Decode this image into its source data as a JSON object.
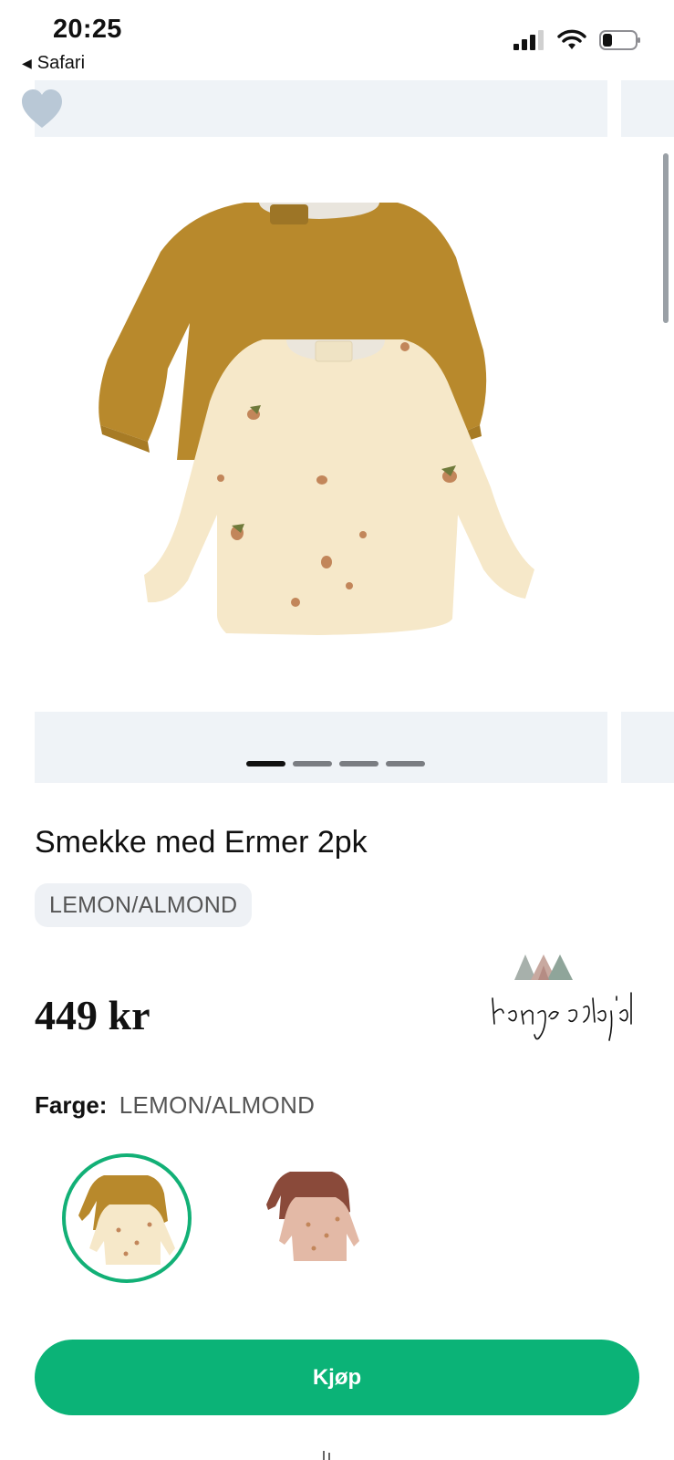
{
  "status_bar": {
    "time": "20:25",
    "back_label": "Safari",
    "icons": [
      "signal-icon",
      "wifi-icon",
      "battery-icon"
    ]
  },
  "gallery": {
    "favorite_icon": "heart-icon",
    "image_alt": "Smekke med Ermer 2pk",
    "slide_count": 4,
    "active_slide": 1
  },
  "product": {
    "title": "Smekke med Ermer 2pk",
    "variant": "LEMON/ALMOND",
    "price": "449 kr",
    "brand": "konges sløjd"
  },
  "color_selector": {
    "label": "Farge:",
    "selected_value": "LEMON/ALMOND",
    "options": [
      "LEMON/ALMOND",
      "second-colour"
    ]
  },
  "actions": {
    "buy_label": "Kjøp"
  },
  "colors": {
    "accent": "#0bb377",
    "band": "#eff3f7",
    "heart": "#b9c8d6"
  }
}
